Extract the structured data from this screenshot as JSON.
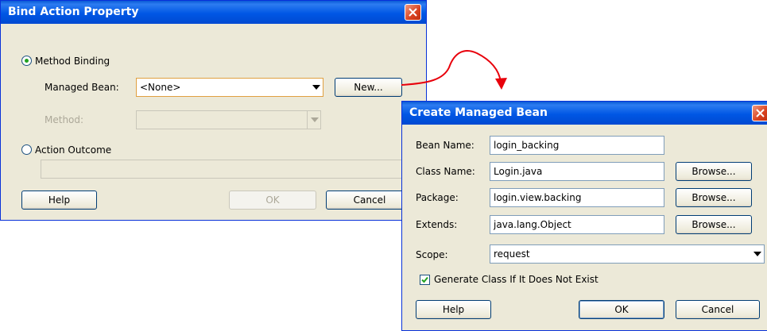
{
  "bind_dialog": {
    "title": "Bind Action Property",
    "method_binding_label": "Method Binding",
    "managed_bean_label": "Managed Bean:",
    "managed_bean_value": "<None>",
    "new_button": "New...",
    "method_label": "Method:",
    "method_value": "",
    "action_outcome_label": "Action Outcome",
    "action_outcome_value": "",
    "help_button": "Help",
    "ok_button": "OK",
    "cancel_button": "Cancel"
  },
  "create_dialog": {
    "title": "Create Managed Bean",
    "bean_name_label": "Bean Name:",
    "bean_name_value": "login_backing",
    "class_name_label": "Class Name:",
    "class_name_value": "Login.java",
    "package_label": "Package:",
    "package_value": "login.view.backing",
    "extends_label": "Extends:",
    "extends_value": "java.lang.Object",
    "scope_label": "Scope:",
    "scope_value": "request",
    "browse_button": "Browse...",
    "generate_label": "Generate Class If It Does Not Exist",
    "help_button": "Help",
    "ok_button": "OK",
    "cancel_button": "Cancel"
  },
  "colors": {
    "arrow": "#e8000b",
    "titlebar": "#0057e5",
    "dialog_bg": "#ece9d8"
  }
}
